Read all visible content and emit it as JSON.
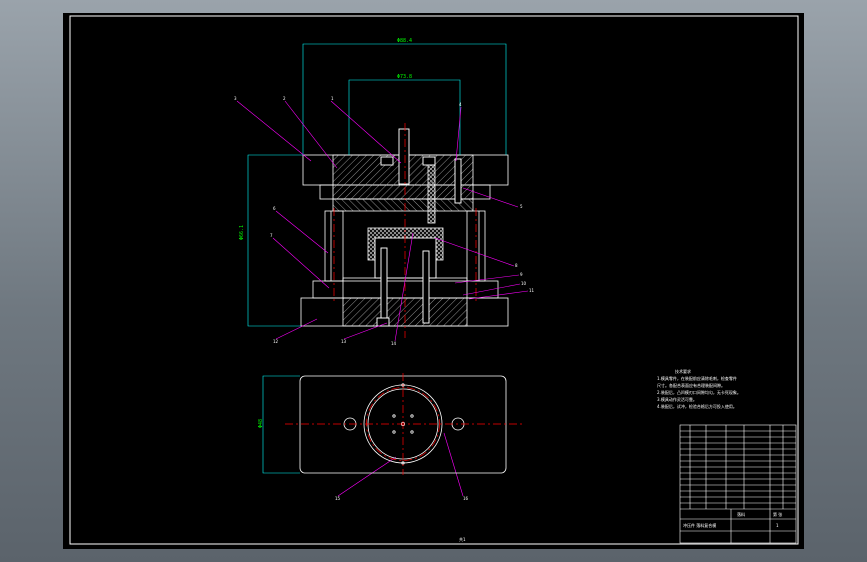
{
  "drawing": {
    "background": "#000000",
    "outline_color": "#ffffff",
    "dimension_color": "#00ffff",
    "dimension_text_color": "#00ff00",
    "centerline_color": "#ff0000",
    "leader_color": "#ff00ff",
    "hatch_color": "#c0c0c0",
    "dims": {
      "top_width": "Φ88.4",
      "inner_width": "Φ73.8",
      "height": "Φ66.1",
      "plan_height": "Φ48"
    },
    "callouts": [
      "3",
      "2",
      "1",
      "4",
      "5",
      "6",
      "7",
      "8",
      "9",
      "10",
      "11",
      "12",
      "13",
      "14",
      "15",
      "16"
    ],
    "notes_title": "技术要求",
    "notes": [
      "1.模具零件，在装配前应清除毛刺，检查零件",
      "尺寸。各配合表面应有合理装配间隙。",
      "2.装配后，凸凹模刃口间隙均匀，无卡死现象。",
      "3.模具动作灵活可靠。",
      "4.装配后，试冲，检验合格后方可投入使用。"
    ],
    "title_block": {
      "name": "落料",
      "sheet_no": "第  张",
      "label": "冲压件 落料复合模",
      "count": "1"
    },
    "page_marker": "共1"
  }
}
